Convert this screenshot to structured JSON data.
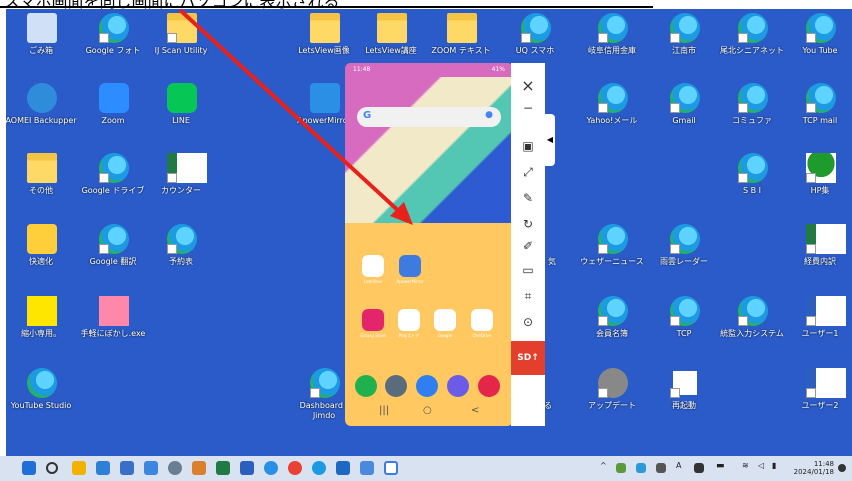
{
  "banner": {
    "text": "スマホ画面を同じ画面にパソコンに表示される"
  },
  "desktop": {
    "icons": [
      {
        "label": "ごみ箱",
        "icon": "recycle-bin-icon"
      },
      {
        "label": "Google フォト",
        "icon": "edge-shortcut-icon"
      },
      {
        "label": "IJ Scan Utility",
        "icon": "folder-shortcut-icon"
      },
      {
        "label": "LetsView画像",
        "icon": "folder-icon"
      },
      {
        "label": "LetsView講座",
        "icon": "folder-icon"
      },
      {
        "label": "ZOOM テキスト",
        "icon": "folder-icon"
      },
      {
        "label": "UQ スマホ",
        "icon": "edge-shortcut-icon"
      },
      {
        "label": "岐阜信用金庫",
        "icon": "edge-shortcut-icon"
      },
      {
        "label": "江南市",
        "icon": "edge-shortcut-icon"
      },
      {
        "label": "尾北シニアネット",
        "icon": "edge-shortcut-icon"
      },
      {
        "label": "You Tube",
        "icon": "edge-shortcut-icon"
      },
      {
        "label": "AOMEI Backupper",
        "icon": "aomei-icon"
      },
      {
        "label": "Zoom",
        "icon": "zoom-icon"
      },
      {
        "label": "LINE",
        "icon": "line-icon"
      },
      {
        "label": "ApowerMirror",
        "icon": "apowermirror-icon"
      },
      {
        "label": "Yahoo!メール",
        "icon": "edge-shortcut-icon"
      },
      {
        "label": "Gmail",
        "icon": "edge-shortcut-icon"
      },
      {
        "label": "コミュファ",
        "icon": "edge-shortcut-icon"
      },
      {
        "label": "TCP mail",
        "icon": "edge-shortcut-icon"
      },
      {
        "label": "その他",
        "icon": "folder-icon"
      },
      {
        "label": "Google ドライブ",
        "icon": "edge-shortcut-icon"
      },
      {
        "label": "カウンター",
        "icon": "excel-icon"
      },
      {
        "label": "S B I",
        "icon": "edge-shortcut-icon"
      },
      {
        "label": "HP集",
        "icon": "tree-icon"
      },
      {
        "label": "快適化",
        "icon": "hat-folder-icon"
      },
      {
        "label": "Google 翻訳",
        "icon": "edge-shortcut-icon"
      },
      {
        "label": "予約表",
        "icon": "edge-shortcut-icon"
      },
      {
        "label": "気",
        "icon": "edge-shortcut-icon"
      },
      {
        "label": "ウェザーニュース",
        "icon": "edge-shortcut-icon"
      },
      {
        "label": "雨雲レーダー",
        "icon": "edge-shortcut-icon"
      },
      {
        "label": "経費内訳",
        "icon": "excel-icon"
      },
      {
        "label": "縮小専用。",
        "icon": "shukusen-icon"
      },
      {
        "label": "手軽にぼかし.exe",
        "icon": "bokashi-icon"
      },
      {
        "label": "会員名簿",
        "icon": "edge-shortcut-icon"
      },
      {
        "label": "TCP",
        "icon": "edge-shortcut-icon"
      },
      {
        "label": "統監入力システム",
        "icon": "edge-shortcut-icon"
      },
      {
        "label": "ユーザー1",
        "icon": "word-icon"
      },
      {
        "label": "YouTube Studio",
        "icon": "edge-shortcut-icon"
      },
      {
        "label": "Dashboard - Jimdo",
        "icon": "edge-shortcut-icon"
      },
      {
        "label": "空にする",
        "icon": "recycle-shortcut-icon"
      },
      {
        "label": "アップデート",
        "icon": "gear-icon"
      },
      {
        "label": "再起動",
        "icon": "restart-icon"
      },
      {
        "label": "ユーザー2",
        "icon": "word-icon"
      }
    ]
  },
  "phone": {
    "status_time": "11:48",
    "status_right": "41%",
    "apps_row1": [
      "LetsView",
      "ApowerMirror"
    ],
    "apps_row2": [
      "Galaxy Store",
      "Playストア",
      "Google",
      "OneDrive"
    ],
    "nav": [
      "|||",
      "○",
      "<"
    ]
  },
  "toolbar": {
    "close": "×",
    "minimize": "−",
    "sd_label": "SD"
  },
  "taskbar": {
    "time": "11:48",
    "date": "2024/01/18",
    "tray_a": "A"
  }
}
